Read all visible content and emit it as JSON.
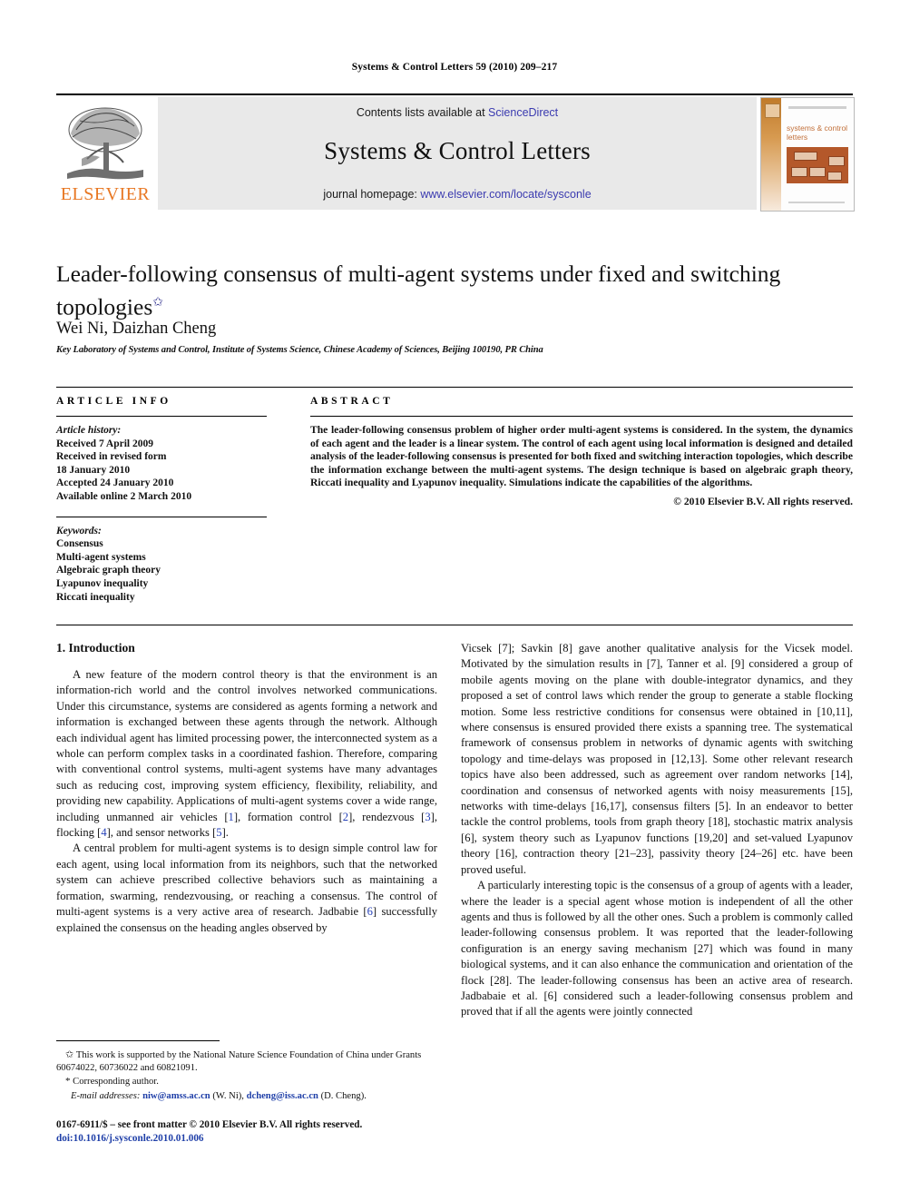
{
  "running_head": "Systems & Control Letters 59 (2010) 209–217",
  "masthead": {
    "contents_prefix": "Contents lists available at ",
    "sciencedirect": "ScienceDirect",
    "journal_title": "Systems & Control Letters",
    "homepage_prefix": "journal homepage: ",
    "homepage_url": "www.elsevier.com/locate/sysconle",
    "publisher_wordmark": "ELSEVIER",
    "publisher_color": "#E87722",
    "link_color": "#3b3bb0",
    "cover_title": "systems & control letters"
  },
  "article": {
    "title": "Leader-following consensus of multi-agent systems under fixed and switching topologies",
    "title_footnote_marker": "✩",
    "authors": "Wei Ni, Daizhan Cheng",
    "corresponding_marker": "*",
    "affiliation": "Key Laboratory of Systems and Control, Institute of Systems Science, Chinese Academy of Sciences, Beijing 100190, PR China"
  },
  "info": {
    "heading": "ARTICLE INFO",
    "history_label": "Article history:",
    "history": [
      "Received 7 April 2009",
      "Received in revised form",
      "18 January 2010",
      "Accepted 24 January 2010",
      "Available online 2 March 2010"
    ],
    "keywords_label": "Keywords:",
    "keywords": [
      "Consensus",
      "Multi-agent systems",
      "Algebraic graph theory",
      "Lyapunov inequality",
      "Riccati inequality"
    ]
  },
  "abstract": {
    "heading": "ABSTRACT",
    "text": "The leader-following consensus problem of higher order multi-agent systems is considered. In the system, the dynamics of each agent and the leader is a linear system. The control of each agent using local information is designed and detailed analysis of the leader-following consensus is presented for both fixed and switching interaction topologies, which describe the information exchange between the multi-agent systems. The design technique is based on algebraic graph theory, Riccati inequality and Lyapunov inequality. Simulations indicate the capabilities of the algorithms.",
    "copyright": "© 2010 Elsevier B.V. All rights reserved."
  },
  "body": {
    "section_number_title": "1. Introduction",
    "left_paragraph_1_a": "A new feature of the modern control theory is that the environment is an information-rich world and the control involves networked communications. Under this circumstance, systems are considered as agents forming a network and information is exchanged between these agents through the network. Although each individual agent has limited processing power, the interconnected system as a whole can perform complex tasks in a coordinated fashion. Therefore, comparing with conventional control systems, multi-agent systems have many advantages such as reducing cost, improving system efficiency, flexibility, reliability, and providing new capability. Applications of multi-agent systems cover a wide range, including unmanned air vehicles [",
    "left_paragraph_1_refs": [
      "1",
      "2",
      "3",
      "4",
      "5"
    ],
    "left_paragraph_1_b": "], formation control [",
    "left_paragraph_1_c": "], rendezvous [",
    "left_paragraph_1_d": "], flocking [",
    "left_paragraph_1_e": "], and sensor networks [",
    "left_paragraph_1_f": "].",
    "left_paragraph_2_a": "A central problem for multi-agent systems is to design simple control law for each agent, using local information from its neighbors, such that the networked system can achieve prescribed collective behaviors such as maintaining a formation, swarming, rendezvousing, or reaching a consensus. The control of multi-agent systems is a very active area of research. Jadbabie [",
    "left_paragraph_2_ref": "6",
    "left_paragraph_2_b": "] successfully explained the consensus on the heading angles observed by",
    "right_paragraph_1": "Vicsek [7]; Savkin [8] gave another qualitative analysis for the Vicsek model. Motivated by the simulation results in [7], Tanner et al. [9] considered a group of mobile agents moving on the plane with double-integrator dynamics, and they proposed a set of control laws which render the group to generate a stable flocking motion. Some less restrictive conditions for consensus were obtained in [10,11], where consensus is ensured provided there exists a spanning tree. The systematical framework of consensus problem in networks of dynamic agents with switching topology and time-delays was proposed in [12,13]. Some other relevant research topics have also been addressed, such as agreement over random networks [14], coordination and consensus of networked agents with noisy measurements [15], networks with time-delays [16,17], consensus filters [5]. In an endeavor to better tackle the control problems, tools from graph theory [18], stochastic matrix analysis [6], system theory such as Lyapunov functions [19,20] and set-valued Lyapunov theory [16], contraction theory [21–23], passivity theory [24–26] etc. have been proved useful.",
    "right_paragraph_2": "A particularly interesting topic is the consensus of a group of agents with a leader, where the leader is a special agent whose motion is independent of all the other agents and thus is followed by all the other ones. Such a problem is commonly called leader-following consensus problem. It was reported that the leader-following configuration is an energy saving mechanism [27] which was found in many biological systems, and it can also enhance the communication and orientation of the flock [28]. The leader-following consensus has been an active area of research. Jadbabaie et al. [6] considered such a leader-following consensus problem and proved that if all the agents were jointly connected"
  },
  "footnotes": {
    "funding_marker": "✩",
    "funding": "This work is supported by the National Nature Science Foundation of China under Grants 60674022, 60736022 and 60821091.",
    "corresponding_marker": "*",
    "corresponding": "Corresponding author.",
    "email_label": "E-mail addresses:",
    "email1": "niw@amss.ac.cn",
    "email1_who": "(W. Ni),",
    "email2": "dcheng@iss.ac.cn",
    "email2_who": "(D. Cheng)."
  },
  "imprint": {
    "issn_line": "0167-6911/$ – see front matter © 2010 Elsevier B.V. All rights reserved.",
    "doi_line": "doi:10.1016/j.sysconle.2010.01.006"
  }
}
